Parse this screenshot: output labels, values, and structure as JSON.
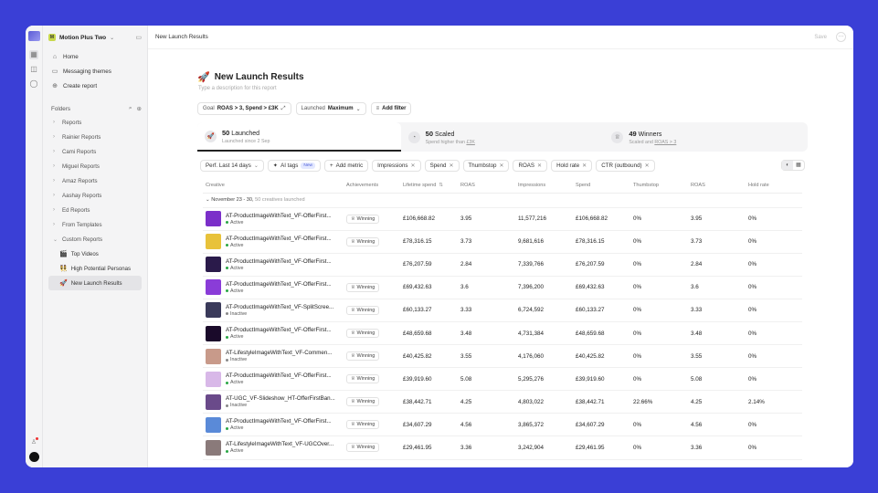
{
  "workspace": {
    "badge": "M",
    "name": "Motion Plus Two"
  },
  "nav": [
    {
      "icon": "home-icon",
      "glyph": "⌂",
      "label": "Home"
    },
    {
      "icon": "message-icon",
      "glyph": "▭",
      "label": "Messaging themes"
    },
    {
      "icon": "plus-circle-icon",
      "glyph": "⊕",
      "label": "Create report"
    }
  ],
  "folders_header": "Folders",
  "folders": [
    "Reports",
    "Rainier Reports",
    "Cami Reports",
    "Miguel Reports",
    "Amaz Reports",
    "Aashay Reports",
    "Ed Reports",
    "From Templates",
    "Custom Reports"
  ],
  "custom_reports": [
    {
      "emoji": "🎬",
      "label": "Top Videos"
    },
    {
      "emoji": "👯",
      "label": "High Potential Personas"
    },
    {
      "emoji": "🚀",
      "label": "New Launch Results"
    }
  ],
  "topbar": {
    "breadcrumb": "New Launch Results",
    "save": "Save"
  },
  "report": {
    "emoji": "🚀",
    "title": "New Launch Results",
    "description_placeholder": "Type a description for this report"
  },
  "filters": [
    {
      "label": "Goal",
      "value": "ROAS > 3, Spend > £3K"
    },
    {
      "label": "Launched",
      "value": "Maximum"
    },
    {
      "label": "",
      "value": "Add filter"
    }
  ],
  "summary": [
    {
      "icon": "rocket-icon",
      "glyph": "🚀",
      "num": "50",
      "label": "Launched",
      "sub": "Launched since 2 Sep",
      "sub_link": ""
    },
    {
      "icon": "scale-icon",
      "glyph": "◔",
      "num": "50",
      "label": "Scaled",
      "sub": "Spend higher than ",
      "sub_link": "£3K"
    },
    {
      "icon": "trophy-icon",
      "glyph": "♕",
      "num": "49",
      "label": "Winners",
      "sub": "Scaled and ",
      "sub_link": "ROAS > 3"
    }
  ],
  "toolbar": {
    "perf": "Perf. Last 14 days",
    "ai_tags": "AI tags",
    "new_badge": "New",
    "add_metric": "Add metric",
    "metrics": [
      "Impressions",
      "Spend",
      "Thumbstop",
      "ROAS",
      "Hold rate",
      "CTR (outbound)"
    ]
  },
  "columns": [
    "Creative",
    "Achievements",
    "Lifetime spend",
    "ROAS",
    "Impressions",
    "Spend",
    "Thumbstop",
    "ROAS",
    "Hold rate"
  ],
  "group": {
    "label": "November 23 - 30,",
    "count": "50 creatives launched"
  },
  "rows": [
    {
      "name": "AT-ProductImageWithText_VF-OfferFirst...",
      "status": "Active",
      "badge": "Winning",
      "lifetime": "£106,668.82",
      "roas": "3.95",
      "impr": "11,577,216",
      "spend": "£106,668.82",
      "thumb": "0%",
      "roas2": "3.95",
      "hold": "0%",
      "color": "#7b2fc9"
    },
    {
      "name": "AT-ProductImageWithText_VF-OfferFirst...",
      "status": "Active",
      "badge": "Winning",
      "lifetime": "£78,316.15",
      "roas": "3.73",
      "impr": "9,681,616",
      "spend": "£78,316.15",
      "thumb": "0%",
      "roas2": "3.73",
      "hold": "0%",
      "color": "#e8c23a"
    },
    {
      "name": "AT-ProductImageWithText_VF-OfferFirst...",
      "status": "Active",
      "badge": "",
      "lifetime": "£76,207.59",
      "roas": "2.84",
      "impr": "7,339,766",
      "spend": "£76,207.59",
      "thumb": "0%",
      "roas2": "2.84",
      "hold": "0%",
      "color": "#2a1a4a"
    },
    {
      "name": "AT-ProductImageWithText_VF-OfferFirst...",
      "status": "Active",
      "badge": "Winning",
      "lifetime": "£69,432.63",
      "roas": "3.6",
      "impr": "7,396,200",
      "spend": "£69,432.63",
      "thumb": "0%",
      "roas2": "3.6",
      "hold": "0%",
      "color": "#8a3cd8"
    },
    {
      "name": "AT-ProductImageWithText_VF-SplitScree...",
      "status": "Inactive",
      "badge": "Winning",
      "lifetime": "£60,133.27",
      "roas": "3.33",
      "impr": "6,724,592",
      "spend": "£60,133.27",
      "thumb": "0%",
      "roas2": "3.33",
      "hold": "0%",
      "color": "#3a3a5a"
    },
    {
      "name": "AT-ProductImageWithText_VF-OfferFirst...",
      "status": "Active",
      "badge": "Winning",
      "lifetime": "£48,659.68",
      "roas": "3.48",
      "impr": "4,731,384",
      "spend": "£48,659.68",
      "thumb": "0%",
      "roas2": "3.48",
      "hold": "0%",
      "color": "#1a0a2a"
    },
    {
      "name": "AT-LifestyleImageWithText_VF-Commen...",
      "status": "Inactive",
      "badge": "Winning",
      "lifetime": "£40,425.82",
      "roas": "3.55",
      "impr": "4,176,060",
      "spend": "£40,425.82",
      "thumb": "0%",
      "roas2": "3.55",
      "hold": "0%",
      "color": "#c89a8a"
    },
    {
      "name": "AT-ProductImageWithText_VF-OfferFirst...",
      "status": "Active",
      "badge": "Winning",
      "lifetime": "£39,919.60",
      "roas": "5.08",
      "impr": "5,295,276",
      "spend": "£39,919.60",
      "thumb": "0%",
      "roas2": "5.08",
      "hold": "0%",
      "color": "#d8b8e8"
    },
    {
      "name": "AT-UGC_VF-Slideshow_HT-OfferFirstBan...",
      "status": "Inactive",
      "badge": "Winning",
      "lifetime": "£38,442.71",
      "roas": "4.25",
      "impr": "4,803,022",
      "spend": "£38,442.71",
      "thumb": "22.66%",
      "roas2": "4.25",
      "hold": "2.14%",
      "color": "#6a4a8a"
    },
    {
      "name": "AT-ProductImageWithText_VF-OfferFirst...",
      "status": "Active",
      "badge": "Winning",
      "lifetime": "£34,607.29",
      "roas": "4.56",
      "impr": "3,865,372",
      "spend": "£34,607.29",
      "thumb": "0%",
      "roas2": "4.56",
      "hold": "0%",
      "color": "#5a8ad8"
    },
    {
      "name": "AT-LifestyleImageWithText_VF-UGCOver...",
      "status": "Active",
      "badge": "Winning",
      "lifetime": "£29,461.95",
      "roas": "3.36",
      "impr": "3,242,904",
      "spend": "£29,461.95",
      "thumb": "0%",
      "roas2": "3.36",
      "hold": "0%",
      "color": "#8a7a7a"
    }
  ],
  "colors": {
    "active": "#2aa745",
    "inactive": "#888888",
    "accent": "#3a3fd6"
  }
}
